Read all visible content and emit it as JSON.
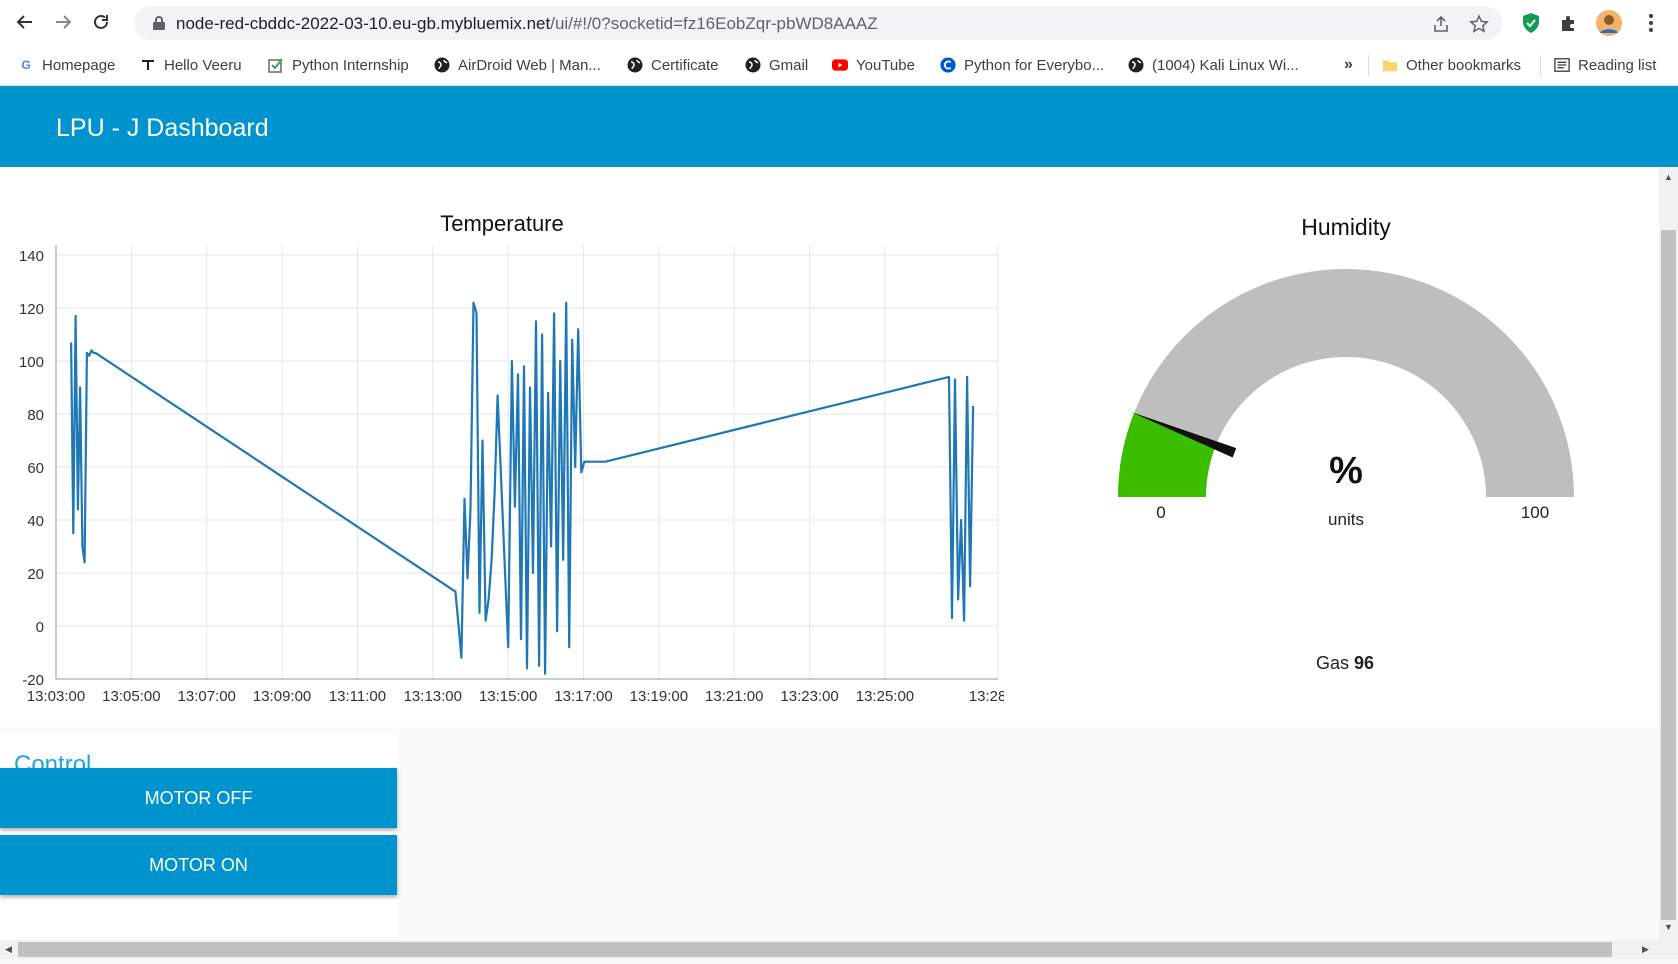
{
  "browser": {
    "url_main": "node-red-cbddc-2022-03-10.eu-gb.mybluemix.net",
    "url_path": "/ui/#!/0?socketid=fz16EobZqr-pbWD8AAAZ",
    "bookmarks": [
      {
        "label": "Homepage",
        "icon": "google-icon"
      },
      {
        "label": "Hello Veeru",
        "icon": "hanger-icon"
      },
      {
        "label": "Python Internship",
        "icon": "checkbox-icon"
      },
      {
        "label": "AirDroid Web | Man...",
        "icon": "globe-icon"
      },
      {
        "label": "Certificate",
        "icon": "globe-icon"
      },
      {
        "label": "Gmail",
        "icon": "globe-icon"
      },
      {
        "label": "YouTube",
        "icon": "youtube-icon"
      },
      {
        "label": "Python for Everybo...",
        "icon": "coursera-icon"
      },
      {
        "label": "(1004) Kali Linux Wi...",
        "icon": "globe-icon"
      }
    ],
    "overflow_label": "»",
    "other_bookmarks": "Other bookmarks",
    "reading_list": "Reading list"
  },
  "dashboard": {
    "title": "LPU - J Dashboard"
  },
  "chart_data": {
    "type": "line",
    "title": "Temperature",
    "xlabel": "",
    "ylabel": "",
    "ylim": [
      -20,
      140
    ],
    "y_ticks": [
      "140",
      "120",
      "100",
      "80",
      "60",
      "40",
      "20",
      "0",
      "-20"
    ],
    "x_ticks": [
      "13:03:00",
      "13:05:00",
      "13:07:00",
      "13:09:00",
      "13:11:00",
      "13:13:00",
      "13:15:00",
      "13:17:00",
      "13:19:00",
      "13:21:00",
      "13:23:00",
      "13:25:00",
      "13:28:00"
    ],
    "x_tick_minutes": [
      0,
      2,
      4,
      6,
      8,
      10,
      12,
      14,
      16,
      18,
      20,
      22,
      25
    ],
    "grid": true,
    "color": "#1f77b4",
    "series": [
      {
        "x_minutes": [
          0.4,
          0.46,
          0.52,
          0.58,
          0.64,
          0.7,
          0.76,
          0.82,
          0.88,
          0.94,
          1.0,
          1.05,
          10.6,
          10.68,
          10.76,
          10.84,
          10.92,
          11.0,
          11.08,
          11.16,
          11.24,
          11.32,
          11.4,
          11.48,
          11.56,
          11.64,
          11.72,
          12.0,
          12.1,
          12.18,
          12.26,
          12.34,
          12.42,
          12.5,
          12.58,
          12.66,
          12.74,
          12.82,
          12.9,
          12.98,
          13.06,
          13.14,
          13.22,
          13.3,
          13.38,
          13.46,
          13.54,
          13.62,
          13.7,
          13.78,
          13.86,
          13.94,
          14.02,
          14.1,
          14.18,
          14.26,
          14.34,
          14.42,
          14.5,
          14.58,
          23.7,
          23.78,
          23.86,
          23.94,
          24.02,
          24.1,
          24.18,
          24.26,
          24.34
        ],
        "y": [
          107,
          35,
          117,
          44,
          90,
          30,
          24,
          103,
          102,
          104,
          103,
          103,
          13,
          1,
          -12,
          48,
          18,
          44,
          122,
          118,
          5,
          70,
          2,
          10,
          25,
          50,
          87,
          -8,
          100,
          45,
          95,
          -5,
          98,
          -16,
          90,
          20,
          115,
          -15,
          110,
          -18,
          88,
          30,
          118,
          -2,
          100,
          25,
          122,
          -8,
          108,
          60,
          112,
          58,
          62,
          62,
          62,
          62,
          62,
          62,
          62,
          62,
          94,
          3,
          93,
          10,
          40,
          2,
          94,
          15,
          83
        ]
      }
    ]
  },
  "humidity": {
    "title": "Humidity",
    "value": 12,
    "min": "0",
    "max": "100",
    "pct": "%",
    "units": "units",
    "fill_color": "#3cbe00",
    "track_color": "#bebebe"
  },
  "gas": {
    "label": "Gas",
    "value": "96"
  },
  "control": {
    "title": "Control",
    "buttons": [
      "MOTOR OFF",
      "MOTOR ON"
    ]
  }
}
